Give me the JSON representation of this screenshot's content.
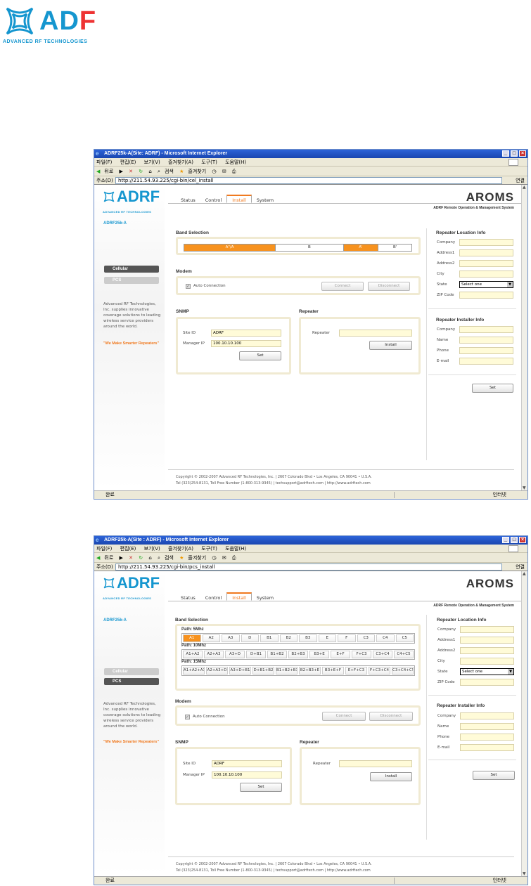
{
  "doc_logo": {
    "text": "AD",
    "text2": "F",
    "sub": "ADVANCED RF TECHNOLOGIES"
  },
  "colors": {
    "brand_blue": "#1596cf",
    "accent_orange": "#f7921e",
    "field_yellow": "#fffbd8",
    "titlebar_blue": "#1a46b0"
  },
  "common": {
    "browser_menu": [
      "파일(F)",
      "편집(E)",
      "보기(V)",
      "즐겨찾기(A)",
      "도구(T)",
      "도움말(H)"
    ],
    "toolbar": [
      "뒤로",
      "검색",
      "즐겨찾기"
    ],
    "address_label": "주소(D)",
    "go_label": "연결",
    "status_done": "완료",
    "status_zone": "인터넷",
    "site_logo": "ADRF",
    "site_logo_sub": "ADVANCED RF TECHNOLOGIES",
    "site_name": "ADRF25k-A",
    "tabs": [
      "Status",
      "Control",
      "Install",
      "System"
    ],
    "aroms_title": "AROMS",
    "aroms_sub": "ADRF Remote Operation & Management System",
    "nav": {
      "cellular": "Cellular",
      "pcs": "PCS"
    },
    "sidebar_desc": "Advanced RF Technologies, Inc. supplies innovative coverage solutions to leading wireless service providers around the world.",
    "slogan": "\"We Make Smarter Repeaters\"",
    "band_selection": "Band Selection",
    "modem": "Modem",
    "auto_connection": "Auto Connection",
    "connect": "Connect",
    "disconnect": "Disconnect",
    "snmp": "SNMP",
    "site_id_label": "Site ID",
    "site_id_value": "ADRF",
    "manager_ip_label": "Manager IP",
    "manager_ip_value": "100.10.10.100",
    "set": "Set",
    "repeater_section": "Repeater",
    "repeater_label": "Repeater",
    "install": "Install",
    "location_title": "Repeater Location Info",
    "location_fields": [
      "Company",
      "Address1",
      "Address2",
      "City",
      "State",
      "ZIP Code"
    ],
    "state_value": "Select one",
    "installer_title": "Repeater Installer Info",
    "installer_fields": [
      "Company",
      "Name",
      "Phone",
      "E-mail"
    ],
    "footer1": "Copyright © 2002-2007 Advanced RF Technologies, Inc. | 2607 Colorado Blvd • Los Angeles, CA 90041 • U.S.A.",
    "footer2": "Tel (323)254-8131, Toll Free Number (1-800-313-9345) | techsupport@adrftech.com | http://www.adrftech.com"
  },
  "window1": {
    "title": "ADRF25k-A(Site: ADRF) - Microsoft Internet Explorer",
    "url": "http://211.54.93.225/cgi-bin/cel_install",
    "bands": [
      "A\"/A",
      "B",
      "A'",
      "B'"
    ],
    "selected_bands": [
      0,
      2
    ]
  },
  "window2": {
    "title": "ADRF25k-A(Site : ADRF) - Microsoft Internet Explorer",
    "url": "http://211.54.93.225/cgi-bin/pcs_install",
    "path5_label": "Path: 5Mhz",
    "path5": [
      "A1",
      "A2",
      "A3",
      "D",
      "B1",
      "B2",
      "B3",
      "E",
      "F",
      "C3",
      "C4",
      "C5"
    ],
    "path10_label": "Path: 10Mhz",
    "path10": [
      "A1+A2",
      "A2+A3",
      "A3+D",
      "D+B1",
      "B1+B2",
      "B2+B3",
      "B3+E",
      "E+F",
      "F+C3",
      "C3+C4",
      "C4+C5"
    ],
    "path15_label": "Path: 15Mhz",
    "path15": [
      "A1+A2+A3",
      "A2+A3+D",
      "A3+D+B1",
      "D+B1+B2",
      "B1+B2+B3",
      "B2+B3+E",
      "B3+E+F",
      "E+F+C3",
      "F+C3+C4",
      "C3+C4+C5"
    ],
    "selected": "A1"
  }
}
